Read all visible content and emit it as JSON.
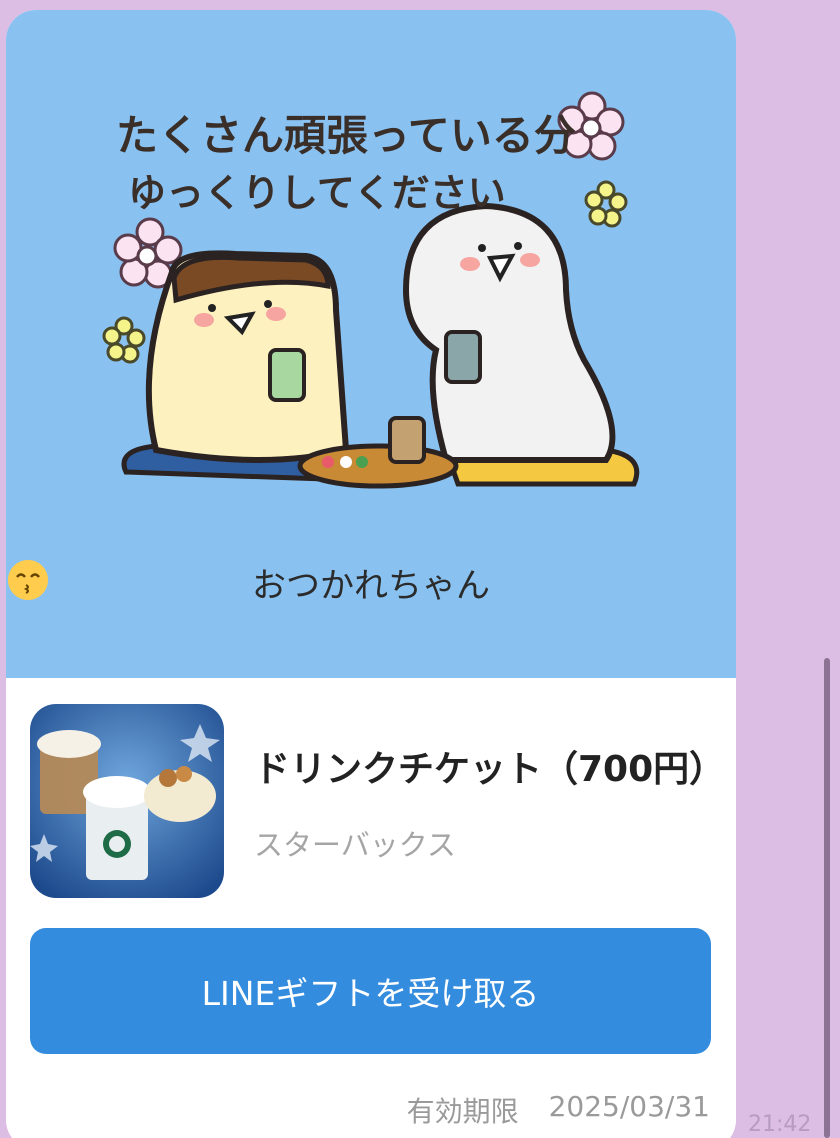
{
  "sticker": {
    "line1": "たくさん頑張っている分",
    "line2": "ゆっくりしてください"
  },
  "message": {
    "text": "おつかれちゃん",
    "left_emoji": "kissing-face-icon",
    "right_emoji": "kissing-smiling-eyes-icon"
  },
  "gift": {
    "title": "ドリンクチケット（700円）",
    "brand": "スターバックス",
    "thumbnail_icon": "starbucks-drinks-image",
    "button_label": "LINEギフトを受け取る",
    "expiry_label": "有効期限",
    "expiry_date": "2025/03/31"
  },
  "timestamp": "21:42",
  "colors": {
    "background": "#dcbde3",
    "card_image_bg": "#89c2f1",
    "button": "#338cde"
  }
}
